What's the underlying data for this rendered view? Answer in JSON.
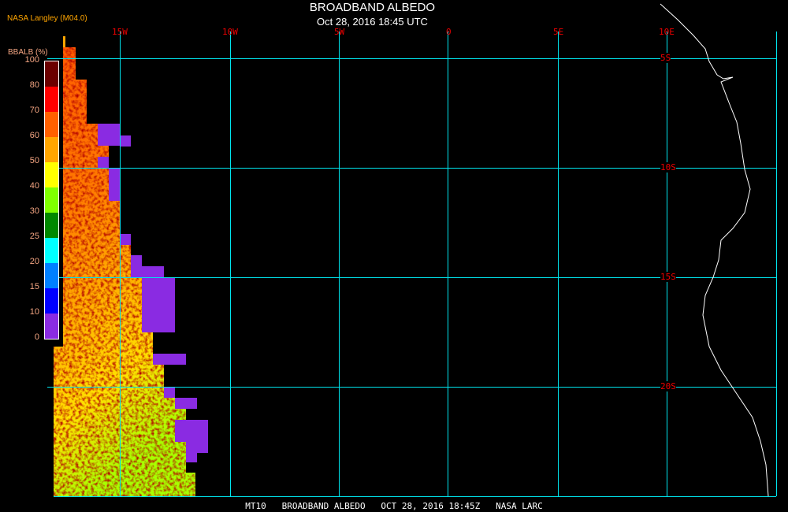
{
  "header": {
    "title": "BROADBAND ALBEDO",
    "subtitle": "Oct 28, 2016 18:45 UTC",
    "organization": "NASA Langley (M04.0)"
  },
  "legend": {
    "title": "BBALB (%)",
    "labels": [
      "100",
      "80",
      "70",
      "60",
      "50",
      "40",
      "30",
      "25",
      "20",
      "15",
      "10",
      "0"
    ],
    "colors": [
      "#6b0000",
      "#ff0000",
      "#ff6000",
      "#ffa500",
      "#ffff00",
      "#80ff00",
      "#008800",
      "#00ffff",
      "#0080ff",
      "#0000ff",
      "#8a2be2"
    ]
  },
  "longitude_labels": [
    "15W",
    "10W",
    "5W",
    "0",
    "5E",
    "10E"
  ],
  "latitude_labels": [
    "5S",
    "10S",
    "15S",
    "20S"
  ],
  "footer": "MT10   BROADBAND ALBEDO   OCT 28, 2016 18:45Z   NASA LARC",
  "colors": {
    "grid": "#00e5ee",
    "geo_label": "#ee0000",
    "coastline": "#ffffff",
    "no_data": "#8a2be2"
  }
}
